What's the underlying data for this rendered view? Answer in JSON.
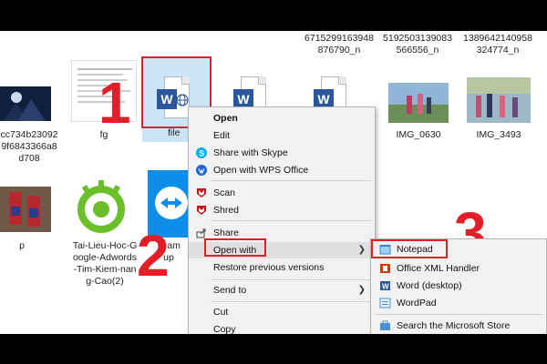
{
  "files": {
    "top_names": [
      {
        "text": "6715299163948\n876790_n"
      },
      {
        "text": "5192503139083\n566556_n"
      },
      {
        "text": "1389642140958\n324774_n"
      }
    ],
    "row1": [
      {
        "label": "cc734b23092\n9f6843366a8\nd708"
      },
      {
        "label": "fg"
      },
      {
        "label": "file"
      },
      {
        "label": "IMG_0630"
      },
      {
        "label": "IMG_3493"
      }
    ],
    "row2": [
      {
        "label": "p"
      },
      {
        "label": "Tai-Lieu-Hoc-G\noogle-Adwords\n-Tim-Kiem-nan\ng-Cao(2)"
      },
      {
        "label": "Team\nup"
      }
    ]
  },
  "context_menu": {
    "items": {
      "open": "Open",
      "edit": "Edit",
      "share_skype": "Share with Skype",
      "open_wps": "Open with WPS Office",
      "scan": "Scan",
      "shred": "Shred",
      "share": "Share",
      "open_with": "Open with",
      "restore": "Restore previous versions",
      "send_to": "Send to",
      "cut": "Cut",
      "copy": "Copy"
    }
  },
  "submenu": {
    "notepad": "Notepad",
    "office_xml": "Office XML Handler",
    "word_desktop": "Word (desktop)",
    "wordpad": "WordPad",
    "store": "Search the Microsoft Store"
  },
  "annotations": {
    "step1": "1",
    "step2": "2",
    "step3": "3",
    "color": "#e21f26"
  },
  "colors": {
    "word_blue": "#2b579a",
    "menu_bg": "#f2f2f2",
    "highlight": "#e21f26"
  }
}
